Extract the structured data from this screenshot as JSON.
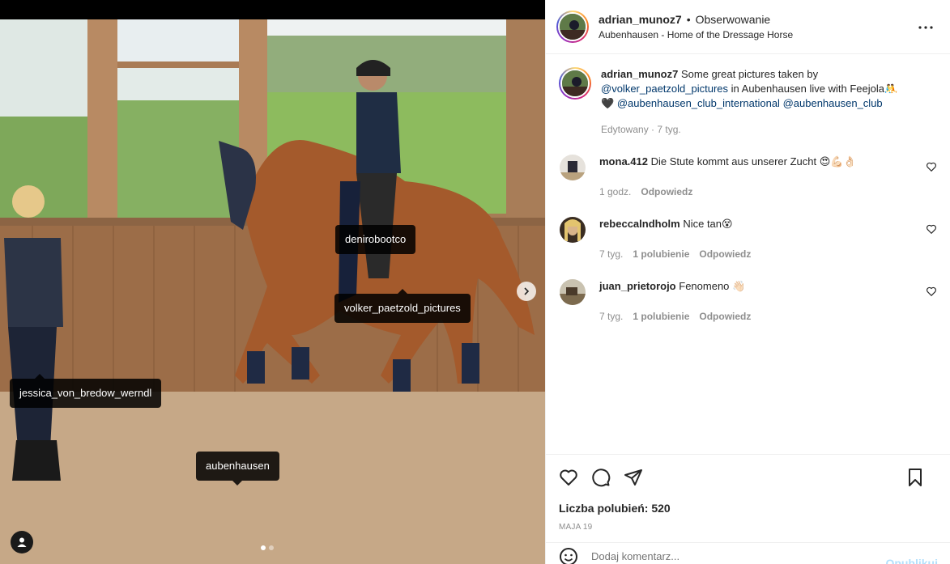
{
  "post": {
    "image_tags": [
      {
        "label": "denirobootco"
      },
      {
        "label": "volker_paetzold_pictures"
      },
      {
        "label": "jessica_von_bredow_werndl"
      },
      {
        "label": "aubenhausen"
      }
    ],
    "carousel": {
      "total": 2,
      "active_index": 1
    }
  },
  "header": {
    "username": "adrian_munoz7",
    "separator": "•",
    "follow_label": "Obserwowanie",
    "location": "Aubenhausen - Home of the Dressage Horse",
    "more_icon": "more-horizontal-icon"
  },
  "caption": {
    "username": "adrian_munoz7",
    "text_part1": "Some great pictures taken by",
    "mention1": "@volker_paetzold_pictures",
    "text_part2": "in Aubenhausen live with Feejola",
    "emoji": "🤼🖤",
    "mention2": "@aubenhausen_club_international",
    "mention3": "@aubenhausen_club",
    "edited": "Edytowany",
    "dot": "·",
    "time": "7 tyg."
  },
  "comments": [
    {
      "username": "mona.412",
      "text": "Die Stute kommt aus unserer Zucht 😍💪🏻👌🏻",
      "time": "1 godz.",
      "likes": "",
      "reply": "Odpowiedz"
    },
    {
      "username": "rebeccalndholm",
      "text": "Nice tan😵",
      "time": "7 tyg.",
      "likes": "1 polubienie",
      "reply": "Odpowiedz"
    },
    {
      "username": "juan_prietorojo",
      "text": "Fenomeno 👋🏻",
      "time": "7 tyg.",
      "likes": "1 polubienie",
      "reply": "Odpowiedz"
    }
  ],
  "actions": {
    "likes_label": "Liczba polubień: 520",
    "date": "MAJA 19"
  },
  "add_comment": {
    "placeholder": "Dodaj komentarz...",
    "publish": "Opublikuj"
  },
  "colors": {
    "link": "#00376b",
    "muted": "#8e8e8e",
    "publish_disabled": "#b2dffc"
  }
}
